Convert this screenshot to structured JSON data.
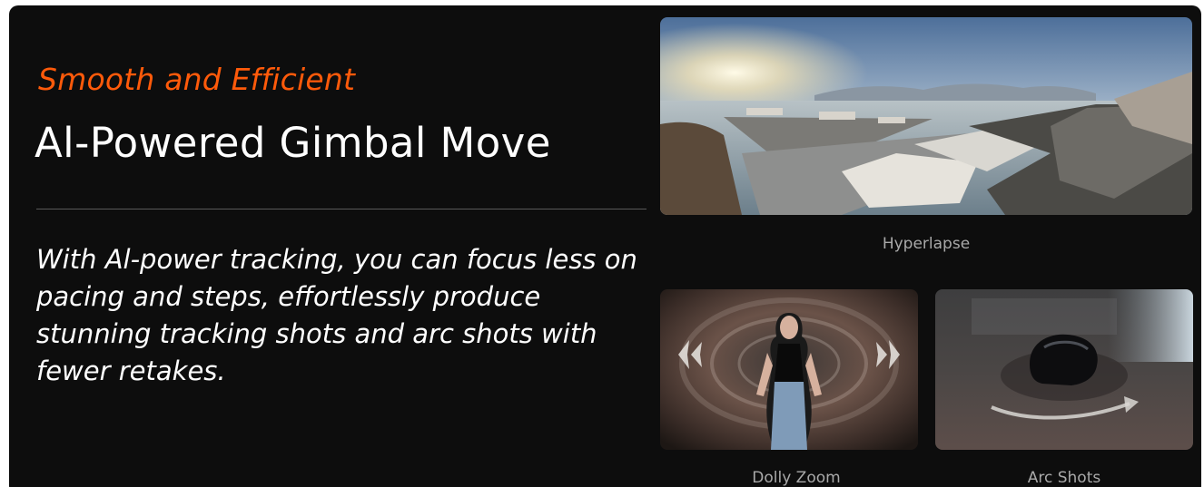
{
  "feature": {
    "eyebrow": "Smooth and Efficient",
    "title": "Al-Powered Gimbal Move",
    "description": "With Al-power tracking, you can focus less on pacing and steps, effortlessly produce stunning tracking shots and arc shots with fewer retakes."
  },
  "modes": [
    {
      "label": "Hyperlapse",
      "image": "harbor-cityscape"
    },
    {
      "label": "Dolly Zoom",
      "image": "woman-in-tunnel"
    },
    {
      "label": "Arc Shots",
      "image": "helmet-orbit"
    }
  ],
  "colors": {
    "panel_background": "#0d0d0d",
    "accent": "#ff5a0a",
    "title": "#ffffff",
    "caption": "#a9a9a9"
  }
}
